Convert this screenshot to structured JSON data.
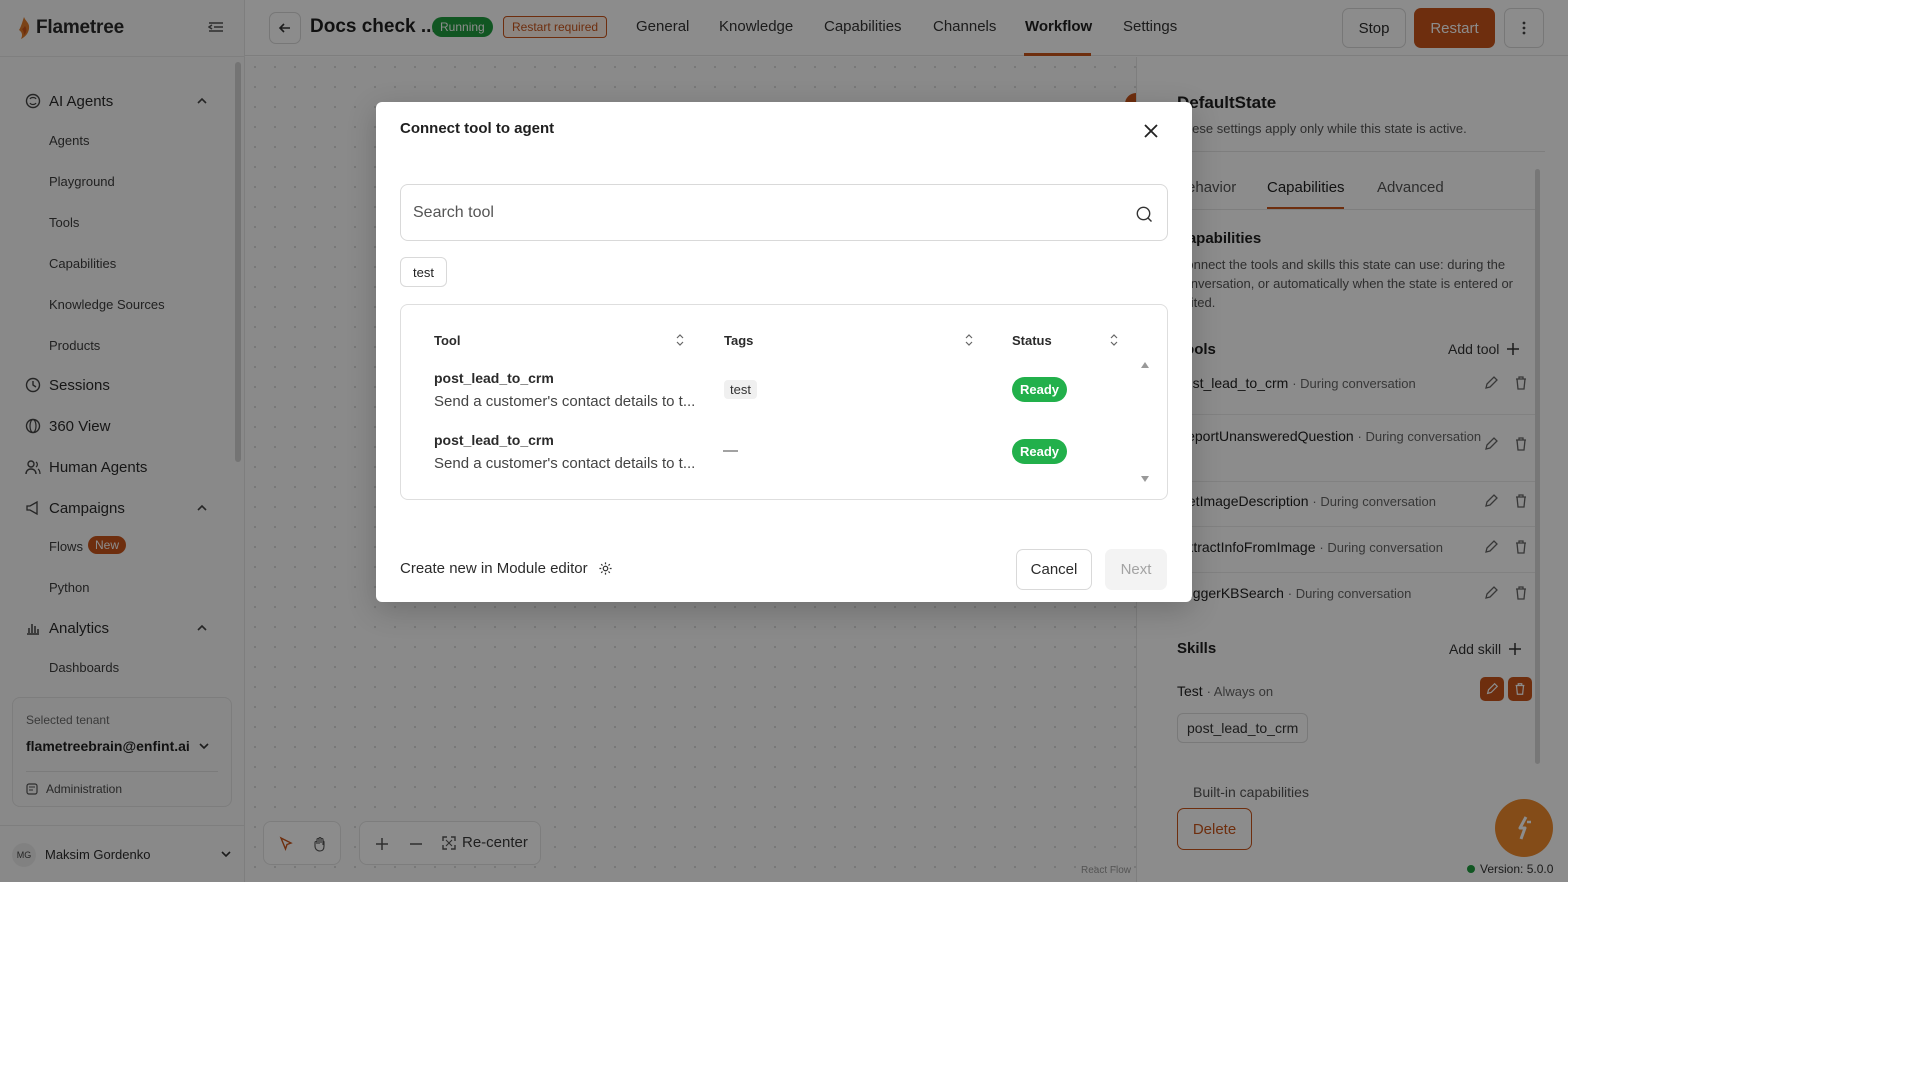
{
  "brand": {
    "name": "Flametree"
  },
  "sidebar": {
    "sections": [
      {
        "label": "AI Agents",
        "icon": "brain-icon",
        "items": [
          "Agents",
          "Playground",
          "Tools",
          "Capabilities",
          "Knowledge Sources",
          "Products"
        ]
      },
      {
        "label": "Sessions",
        "icon": "clock-icon"
      },
      {
        "label": "360 View",
        "icon": "globe-icon"
      },
      {
        "label": "Human Agents",
        "icon": "users-icon"
      },
      {
        "label": "Campaigns",
        "icon": "megaphone-icon",
        "items": [
          "Flows",
          "Python"
        ],
        "flows_badge": "New"
      },
      {
        "label": "Analytics",
        "icon": "bar-chart-icon",
        "items": [
          "Dashboards"
        ]
      }
    ],
    "tenant": {
      "caption": "Selected tenant",
      "email": "flametreebrain@enfint.ai",
      "admin_label": "Administration"
    },
    "user": {
      "initials": "MG",
      "name": "Maksim Gordenko"
    }
  },
  "header": {
    "agent_title": "Docs check ...",
    "status_running": "Running",
    "status_restart": "Restart required",
    "tabs": [
      "General",
      "Knowledge",
      "Capabilities",
      "Channels",
      "Workflow",
      "Settings"
    ],
    "active_tab": "Workflow",
    "stop_label": "Stop",
    "restart_label": "Restart"
  },
  "canvas": {
    "recenter_label": "Re-center",
    "attribution": "React Flow"
  },
  "right_panel": {
    "title": "DefaultState",
    "subtitle": "These settings apply only while this state is active.",
    "tabs": [
      "Behavior",
      "Capabilities",
      "Advanced"
    ],
    "active_tab": "Capabilities",
    "capabilities_heading": "Capabilities",
    "capabilities_desc": "Connect the tools and skills this state can use: during the conversation, or automatically when the state is entered or exited.",
    "tools_heading": "Tools",
    "add_tool_label": "Add tool",
    "tools": [
      {
        "name": "post_lead_to_crm",
        "when": "· During conversation"
      },
      {
        "name": "ReportUnansweredQuestion",
        "when": "· During conversation"
      },
      {
        "name": "GetImageDescription",
        "when": "· During conversation"
      },
      {
        "name": "ExtractInfoFromImage",
        "when": "· During conversation"
      },
      {
        "name": "TriggerKBSearch",
        "when": "· During conversation"
      }
    ],
    "skills_heading": "Skills",
    "add_skill_label": "Add skill",
    "skill": {
      "name": "Test",
      "when": "· Always on",
      "chip": "post_lead_to_crm"
    },
    "builtin_label": "Built-in capabilities",
    "delete_label": "Delete",
    "version": "Version: 5.0.0"
  },
  "modal": {
    "title": "Connect tool to agent",
    "search_placeholder": "Search tool",
    "filter_chip": "test",
    "columns": [
      "Tool",
      "Tags",
      "Status"
    ],
    "rows": [
      {
        "name": "post_lead_to_crm",
        "desc": "Send a customer's contact details to t...",
        "tag": "test",
        "status": "Ready"
      },
      {
        "name": "post_lead_to_crm",
        "desc": "Send a customer's contact details to t...",
        "tag": "—",
        "status": "Ready"
      }
    ],
    "create_label": "Create new in Module editor",
    "cancel_label": "Cancel",
    "next_label": "Next"
  },
  "colors": {
    "accent": "#c8551b",
    "success": "#22b04b",
    "fab": "#f08a2c"
  }
}
